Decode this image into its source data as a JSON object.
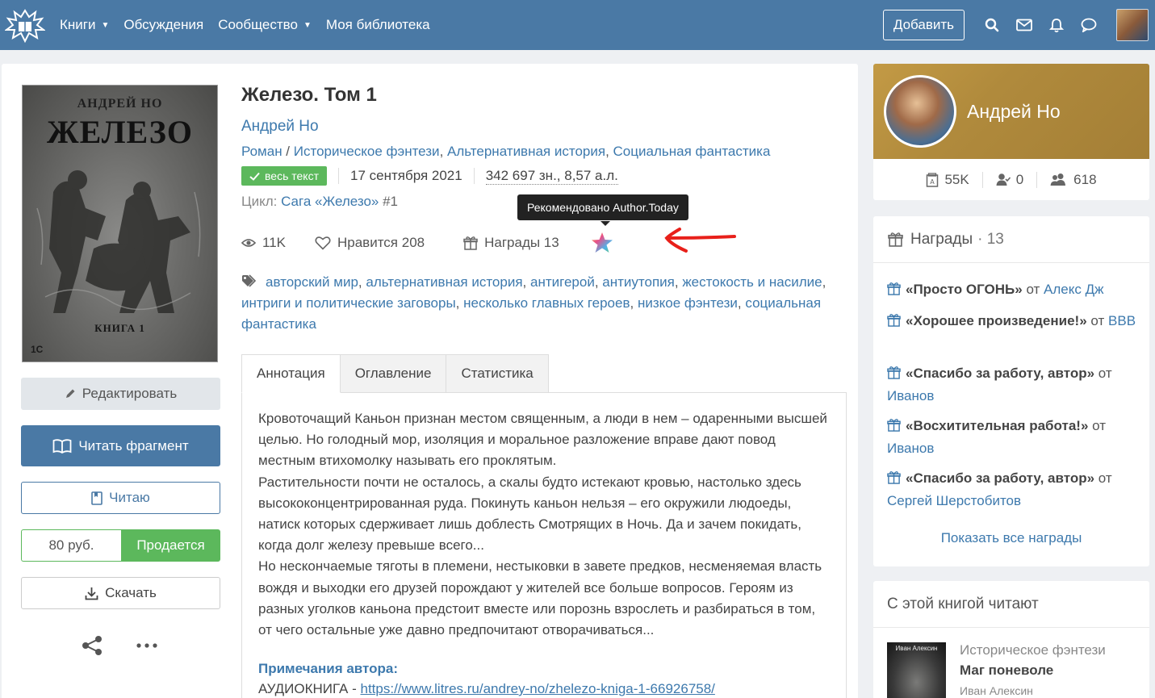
{
  "nav": {
    "items": [
      {
        "label": "Книги",
        "caret": true
      },
      {
        "label": "Обсуждения",
        "caret": false
      },
      {
        "label": "Сообщество",
        "caret": true
      },
      {
        "label": "Моя библиотека",
        "caret": false
      }
    ],
    "add_label": "Добавить",
    "icons": [
      "search-icon",
      "envelope-icon",
      "bell-icon",
      "chat-icon"
    ]
  },
  "cover": {
    "author": "АНДРЕЙ НО",
    "title": "ЖЕЛЕЗО",
    "book": "КНИГА 1",
    "publisher": "1С"
  },
  "sidebar": {
    "edit_label": "Редактировать",
    "read_label": "Читать фрагмент",
    "reading_label": "Читаю",
    "price": "80 руб.",
    "sale_label": "Продается",
    "download_label": "Скачать"
  },
  "book": {
    "title": "Железо. Том 1",
    "author": "Андрей Но",
    "genres": [
      "Роман",
      "Историческое фэнтези",
      "Альтернативная история",
      "Социальная фантастика"
    ],
    "badge": "весь текст",
    "date": "17 сентября 2021",
    "size": "342 697 зн., 8,57 а.л.",
    "cycle_label": "Цикл:",
    "cycle_name": "Сага «Железо»",
    "cycle_num": "#1",
    "views": "11K",
    "likes": "Нравится 208",
    "awards": "Награды 13",
    "tooltip": "Рекомендовано Author.Today",
    "tags": [
      "авторский мир",
      "альтернативная история",
      "антигерой",
      "антиутопия",
      "жестокость и насилие",
      "интриги и политические заговоры",
      "несколько главных героев",
      "низкое фэнтези",
      "социальная фантастика"
    ]
  },
  "tabs": [
    "Аннотация",
    "Оглавление",
    "Статистика"
  ],
  "annotation": [
    "Кровоточащий Каньон признан местом священным, а люди в нем – одаренными высшей целью. Но голодный мор, изоляция и моральное разложение вправе дают повод местным втихомолку называть его проклятым.",
    "Растительности почти не осталось, а скалы будто истекают кровью, настолько здесь высококонцентрированная руда. Покинуть каньон нельзя – его окружили людоеды, натиск которых сдерживает лишь доблесть Смотрящих в Ночь. Да и зачем покидать, когда долг железу превыше всего...",
    "Но нескончаемые тяготы в племени, нестыковки в завете предков, несменяемая власть вождя и выходки его друзей порождают у жителей все больше вопросов. Героям из разных уголков каньона предстоит вместе или порознь взрослеть и разбираться в том, от чего остальные уже давно предпочитают отворачиваться..."
  ],
  "notes": {
    "heading": "Примечания автора:",
    "prefix": "АУДИОКНИГА - ",
    "link": "https://www.litres.ru/andrey-no/zhelezo-kniga-1-66926758/"
  },
  "author_card": {
    "name": "Андрей Но",
    "stat1": "55K",
    "stat2": "0",
    "stat3": "618"
  },
  "awards_card": {
    "title": "Награды",
    "count": "· 13",
    "items": [
      {
        "name": "«Просто ОГОНЬ»",
        "from": "от",
        "user": "Алекс Дж"
      },
      {
        "name": "«Хорошее произведение!»",
        "from": "от",
        "user": "ВВВ"
      },
      {
        "name": "«Спасибо за работу, автор»",
        "from": "от",
        "user": "Иванов"
      },
      {
        "name": "«Восхитительная работа!»",
        "from": "от",
        "user": "Иванов"
      },
      {
        "name": "«Спасибо за работу, автор»",
        "from": "от",
        "user": "Сергей Шерстобитов"
      }
    ],
    "show_all": "Показать все награды"
  },
  "also": {
    "title": "С этой книгой читают",
    "cover_author": "Иван Алексин",
    "genre": "Историческое фэнтези",
    "book_title": "Маг поневоле",
    "author": "Иван Алексин"
  },
  "colors": {
    "nav": "#4a79a5",
    "link": "#3d79ad",
    "success": "#5cb85c"
  }
}
